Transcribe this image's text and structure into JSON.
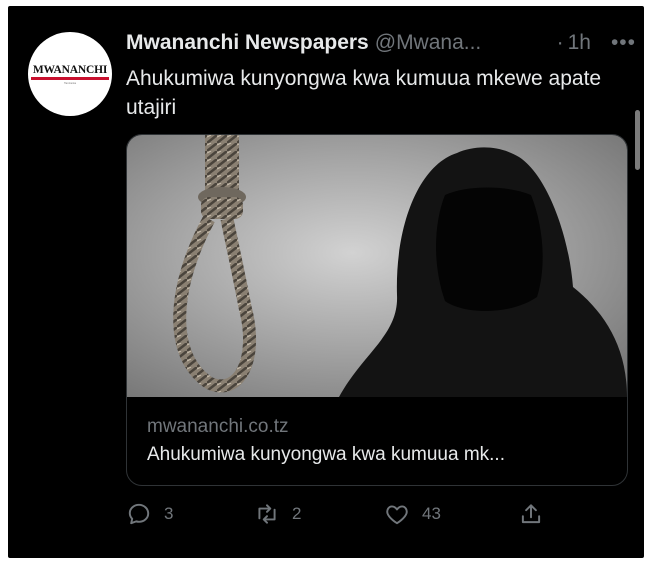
{
  "tweet": {
    "avatar_logo": "MWANANCHI",
    "avatar_tagline": "Tanzania",
    "display_name": "Mwananchi Newspapers",
    "handle": "@Mwana...",
    "dot": "·",
    "time": "1h",
    "more_icon": "more-icon",
    "text": "Ahukumiwa kunyongwa kwa kumuua mkewe apate utajiri",
    "card": {
      "domain": "mwananchi.co.tz",
      "title": "Ahukumiwa kunyongwa kwa kumuua mk..."
    },
    "actions": {
      "reply_count": "3",
      "retweet_count": "2",
      "like_count": "43"
    }
  },
  "colors": {
    "background": "#000000",
    "primary_text": "#e7e9ea",
    "secondary_text": "#71767b",
    "border": "#2f3336"
  }
}
